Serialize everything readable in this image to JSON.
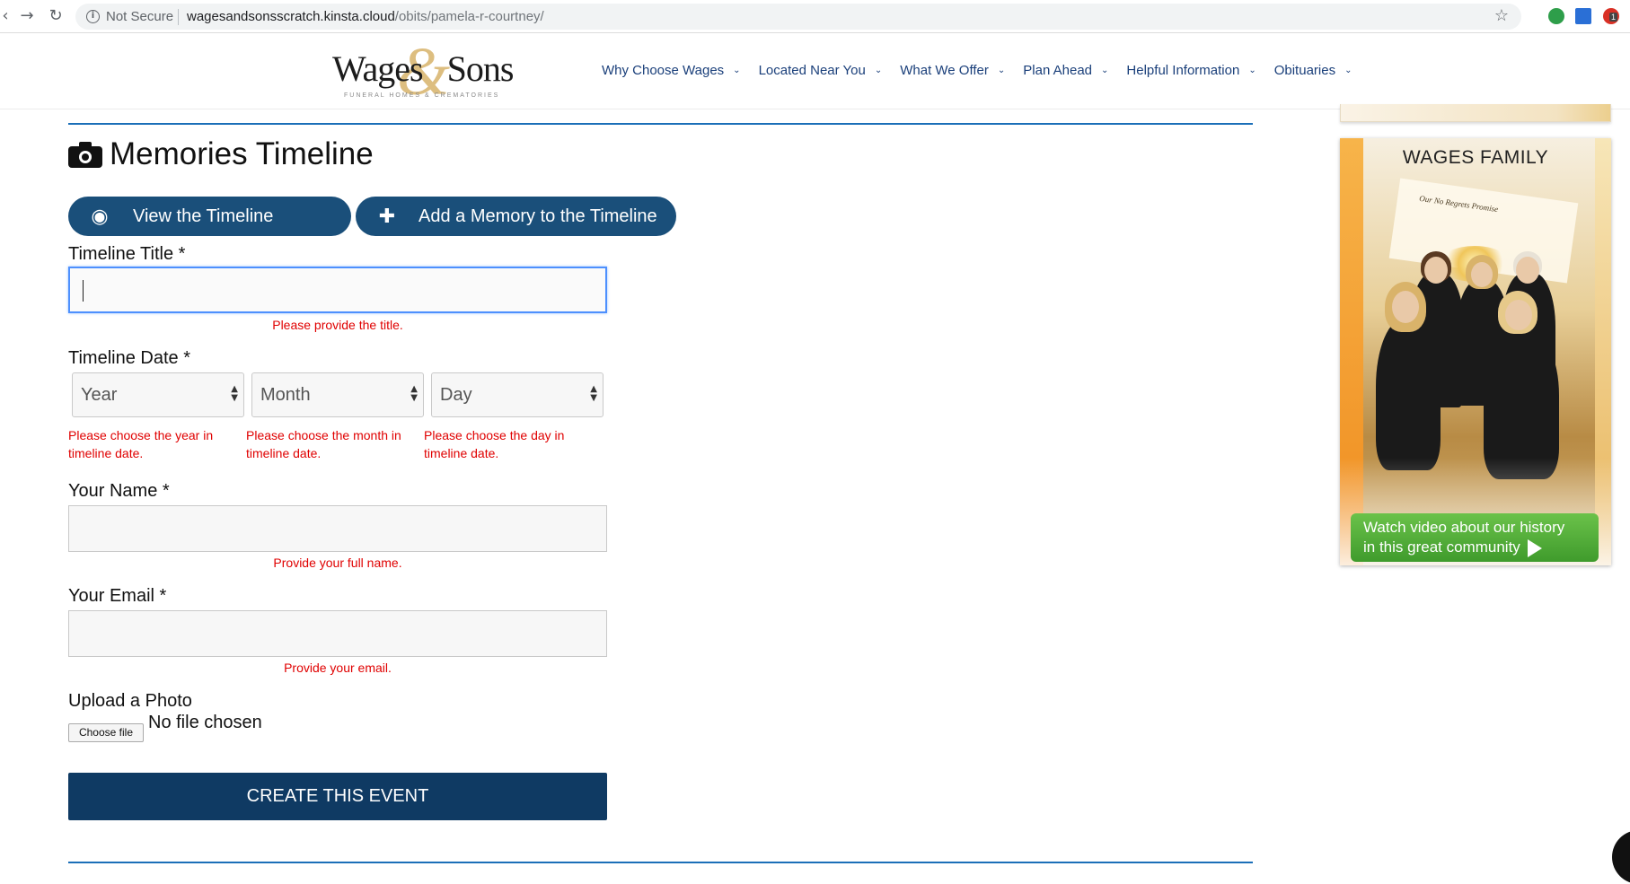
{
  "browser": {
    "security": "Not Secure",
    "url_host": "wagesandsonsscratch.kinsta.cloud",
    "url_path": "/obits/pamela-r-courtney/",
    "extension_badge": "1"
  },
  "logo": {
    "name": "Wages Sons",
    "tagline": "FUNERAL HOMES & CREMATORIES"
  },
  "nav": [
    {
      "label": "Why Choose Wages"
    },
    {
      "label": "Located Near You"
    },
    {
      "label": "What We Offer"
    },
    {
      "label": "Plan Ahead"
    },
    {
      "label": "Helpful Information"
    },
    {
      "label": "Obituaries"
    }
  ],
  "section": {
    "title": "Memories Timeline",
    "view_button": "View the Timeline",
    "add_button": "Add a Memory to the Timeline"
  },
  "form": {
    "title_label": "Timeline Title *",
    "title_error": "Please provide the title.",
    "date_label": "Timeline Date *",
    "year_placeholder": "Year",
    "month_placeholder": "Month",
    "day_placeholder": "Day",
    "year_error": "Please choose the year in timeline date.",
    "month_error": "Please choose the month in timeline date.",
    "day_error": "Please choose the day in timeline date.",
    "name_label": "Your Name *",
    "name_error": "Provide your full name.",
    "email_label": "Your Email *",
    "email_error": "Provide your email.",
    "photo_label": "Upload a Photo",
    "file_button": "Choose file",
    "file_status": "No file chosen",
    "submit": "CREATE THIS EVENT"
  },
  "sidebar": {
    "ad_title": "WAGES FAMILY",
    "ad_promise": "Our No Regrets Promise",
    "cta_line1": "Watch video about our history",
    "cta_line2": "in this great community"
  },
  "colors": {
    "pill": "#1a4f7a",
    "submit": "#0f3a63",
    "error": "#e00000",
    "rule": "#1b6fb8",
    "nav_text": "#1a3f7a"
  }
}
